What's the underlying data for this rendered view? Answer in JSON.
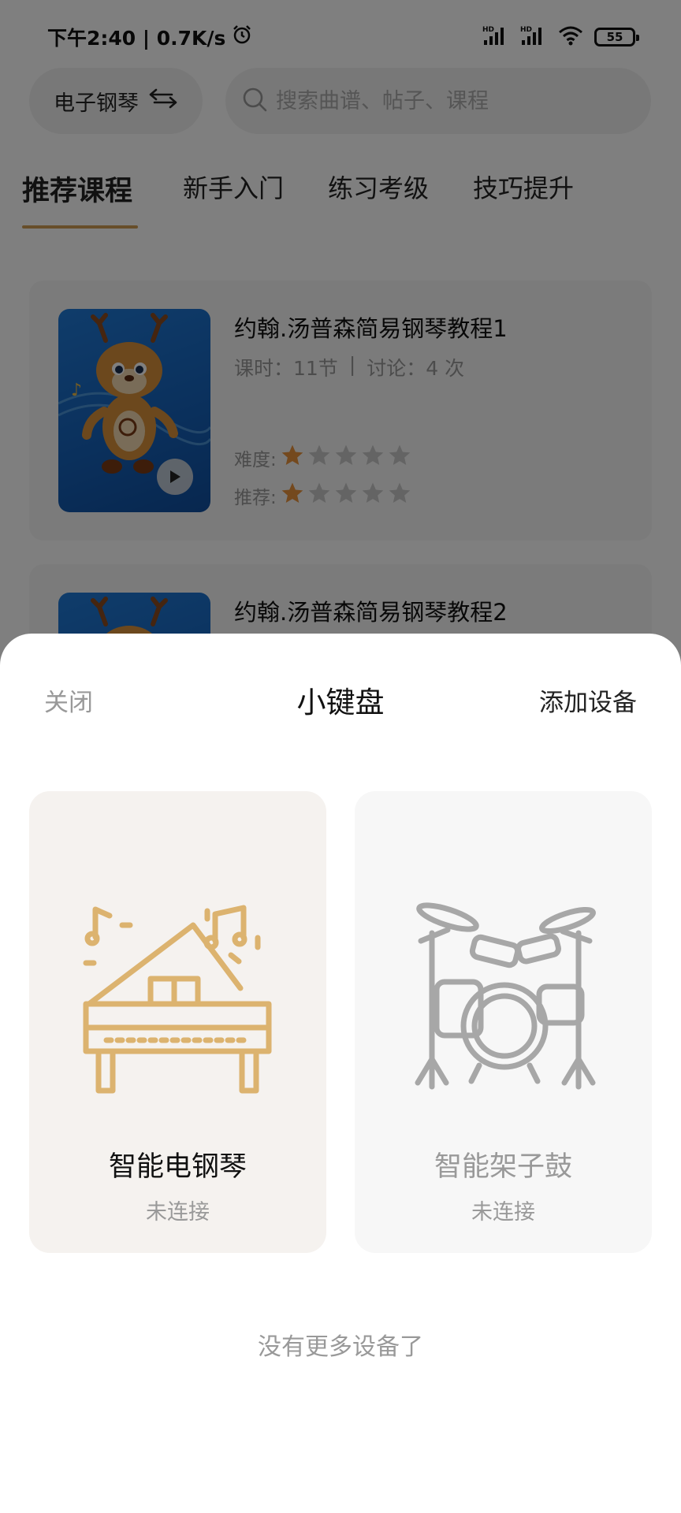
{
  "status_bar": {
    "time_speed": "下午2:40 | 0.7K/s",
    "icons": [
      "alarm-icon",
      "signal-hd-icon",
      "signal-hd-icon",
      "wifi-icon",
      "battery-icon"
    ],
    "network_label_1": "HD",
    "network_label_2": "HD",
    "battery": "55"
  },
  "header": {
    "instrument_label": "电子钢琴",
    "search_placeholder": "搜索曲谱、帖子、课程"
  },
  "tabs": [
    {
      "label": "推荐课程",
      "active": true
    },
    {
      "label": "新手入门",
      "active": false
    },
    {
      "label": "练习考级",
      "active": false
    },
    {
      "label": "技巧提升",
      "active": false
    }
  ],
  "courses": [
    {
      "title": "约翰.汤普森简易钢琴教程1",
      "lessons": "课时：11节",
      "separator": "|",
      "discussions": "讨论：4 次",
      "difficulty_label": "难度:",
      "recommend_label": "推荐:",
      "difficulty_stars": 1,
      "recommend_stars": 1,
      "max_stars": 5
    },
    {
      "title": "约翰.汤普森简易钢琴教程2"
    }
  ],
  "sheet": {
    "close_label": "关闭",
    "title": "小键盘",
    "add_label": "添加设备",
    "devices": [
      {
        "name": "智能电钢琴",
        "status": "未连接",
        "icon": "piano-icon"
      },
      {
        "name": "智能架子鼓",
        "status": "未连接",
        "icon": "drum-kit-icon"
      }
    ],
    "footer": "没有更多设备了"
  },
  "colors": {
    "accent": "#cf9d54",
    "star_active": "#e8933c",
    "star_inactive": "#c8c8c8",
    "piano_illustration": "#dcb36f",
    "drum_illustration": "#a7a7a7"
  }
}
